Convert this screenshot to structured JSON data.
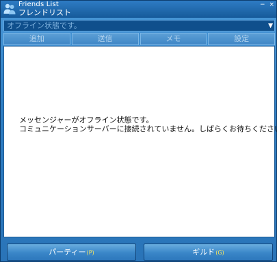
{
  "window": {
    "title_en": "Friends List",
    "title_ja": "フレンドリスト",
    "minimize_glyph": "−",
    "close_glyph": "×"
  },
  "status": {
    "value": "オフライン状態です。",
    "caret": "▼"
  },
  "toolbar": [
    {
      "label": "追加"
    },
    {
      "label": "送信"
    },
    {
      "label": "メモ"
    },
    {
      "label": "設定"
    }
  ],
  "message": {
    "line1": "メッセンジャーがオフライン状態です。",
    "line2": "コミュニケーションサーバーに接続されていません。しばらくお待ちください。"
  },
  "buttons": {
    "party_label": "パーティー",
    "party_key": "(P)",
    "guild_label": "ギルド",
    "guild_key": "(G)"
  },
  "icons": {
    "app": "friends-people-icon"
  },
  "colors": {
    "window_blue": "#2f7fc4",
    "titlebar": "#165a9a",
    "content_bg": "#ffffff",
    "hotkey": "#ffe95a"
  }
}
